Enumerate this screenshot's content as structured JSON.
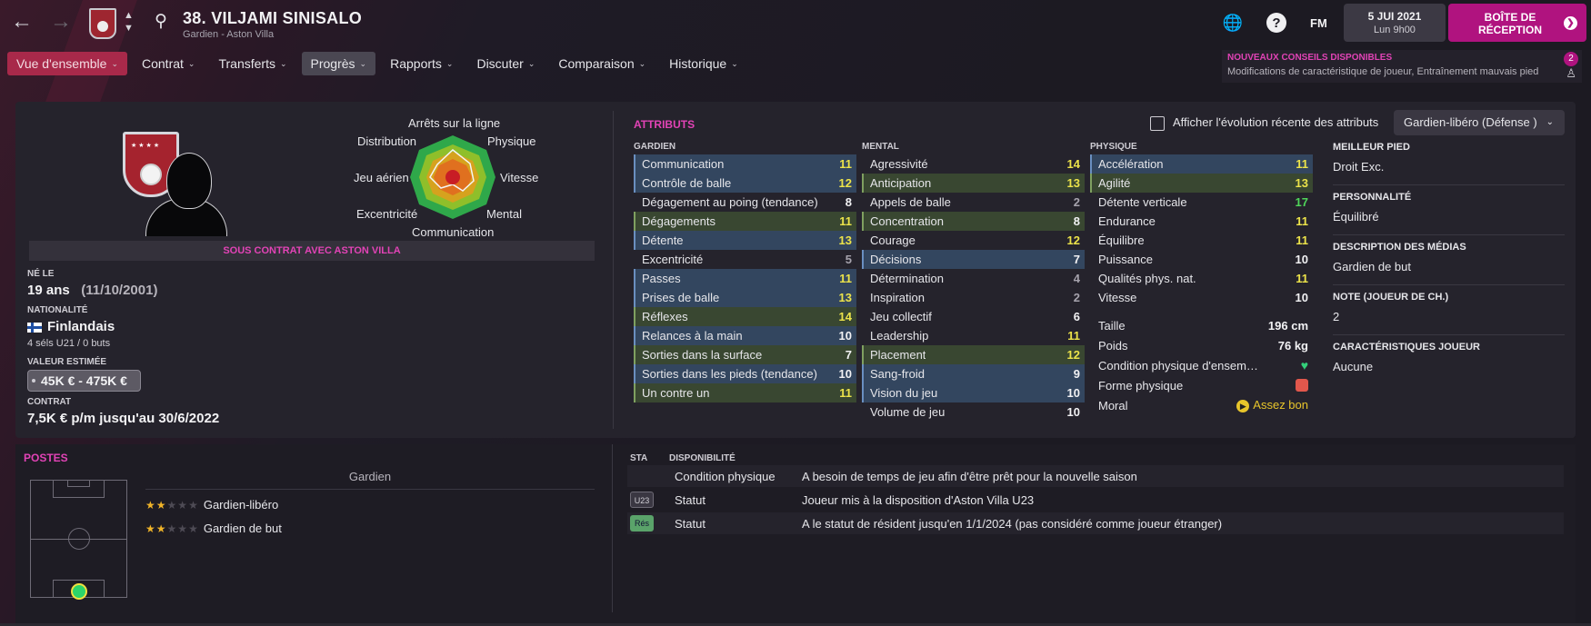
{
  "header": {
    "player_title": "38. VILJAMI SINISALO",
    "player_subtitle": "Gardien - Aston Villa",
    "fm_label": "FM",
    "date_main": "5 JUI 2021",
    "date_sub": "Lun 9h00",
    "inbox_label": "BOÎTE DE RÉCEPTION",
    "help_glyph": "?",
    "icons": [
      "back-arrow-icon",
      "forward-arrow-icon",
      "club-badge-icon",
      "search-icon",
      "globe-icon",
      "help-icon",
      "chevron-right-icon"
    ]
  },
  "tabs": [
    {
      "label": "Vue d'ensemble",
      "state": "active"
    },
    {
      "label": "Contrat"
    },
    {
      "label": "Transferts"
    },
    {
      "label": "Progrès",
      "state": "hover"
    },
    {
      "label": "Rapports"
    },
    {
      "label": "Discuter"
    },
    {
      "label": "Comparaison"
    },
    {
      "label": "Historique"
    }
  ],
  "notification": {
    "title": "NOUVEAUX CONSEILS DISPONIBLES",
    "text": "Modifications de caractéristique de joueur, Entraînement mauvais pied",
    "badge": "2"
  },
  "radar": {
    "labels": {
      "top": "Arrêts sur la ligne",
      "top_left": "Distribution",
      "top_right": "Physique",
      "left": "Jeu aérien",
      "right": "Vitesse",
      "bottom_left": "Excentricité",
      "bottom_right": "Mental",
      "bottom": "Communication"
    }
  },
  "profile": {
    "contract_banner": "SOUS CONTRAT AVEC ASTON VILLA",
    "born_label": "NÉ LE",
    "age": "19 ans",
    "birth_date": "(11/10/2001)",
    "nationality_label": "NATIONALITÉ",
    "nationality": "Finlandais",
    "caps": "4 séls U21 / 0 buts",
    "value_label": "VALEUR ESTIMÉE",
    "value": "45K € - 475K €",
    "contract_label": "CONTRAT",
    "contract": "7,5K € p/m jusqu'au 30/6/2022"
  },
  "attributes": {
    "title": "ATTRIBUTS",
    "show_recent_label": "Afficher l'évolution récente des attributs",
    "role_select": "Gardien-libéro (Défense )",
    "goalkeeper_head": "GARDIEN",
    "mental_head": "MENTAL",
    "physical_head": "PHYSIQUE",
    "goalkeeper": [
      {
        "name": "Communication",
        "value": "11",
        "hl": "b",
        "tone": "yellow"
      },
      {
        "name": "Contrôle de balle",
        "value": "12",
        "hl": "b",
        "tone": "yellow"
      },
      {
        "name": "Dégagement au poing (tendance)",
        "value": "8",
        "hl": "",
        "tone": "white"
      },
      {
        "name": "Dégagements",
        "value": "11",
        "hl": "g",
        "tone": "yellow"
      },
      {
        "name": "Détente",
        "value": "13",
        "hl": "b",
        "tone": "yellow"
      },
      {
        "name": "Excentricité",
        "value": "5",
        "hl": "",
        "tone": "grey"
      },
      {
        "name": "Passes",
        "value": "11",
        "hl": "b",
        "tone": "yellow"
      },
      {
        "name": "Prises de balle",
        "value": "13",
        "hl": "b",
        "tone": "yellow"
      },
      {
        "name": "Réflexes",
        "value": "14",
        "hl": "g",
        "tone": "yellow"
      },
      {
        "name": "Relances à la main",
        "value": "10",
        "hl": "b",
        "tone": "white"
      },
      {
        "name": "Sorties dans la surface",
        "value": "7",
        "hl": "g",
        "tone": "white"
      },
      {
        "name": "Sorties dans les pieds (tendance)",
        "value": "10",
        "hl": "b",
        "tone": "white"
      },
      {
        "name": "Un contre un",
        "value": "11",
        "hl": "g",
        "tone": "yellow"
      }
    ],
    "mental": [
      {
        "name": "Agressivité",
        "value": "14",
        "hl": "",
        "tone": "yellow"
      },
      {
        "name": "Anticipation",
        "value": "13",
        "hl": "g",
        "tone": "yellow"
      },
      {
        "name": "Appels de balle",
        "value": "2",
        "hl": "",
        "tone": "grey"
      },
      {
        "name": "Concentration",
        "value": "8",
        "hl": "g",
        "tone": "white"
      },
      {
        "name": "Courage",
        "value": "12",
        "hl": "",
        "tone": "yellow"
      },
      {
        "name": "Décisions",
        "value": "7",
        "hl": "b",
        "tone": "white"
      },
      {
        "name": "Détermination",
        "value": "4",
        "hl": "",
        "tone": "grey"
      },
      {
        "name": "Inspiration",
        "value": "2",
        "hl": "",
        "tone": "grey"
      },
      {
        "name": "Jeu collectif",
        "value": "6",
        "hl": "",
        "tone": "white"
      },
      {
        "name": "Leadership",
        "value": "11",
        "hl": "",
        "tone": "yellow"
      },
      {
        "name": "Placement",
        "value": "12",
        "hl": "g",
        "tone": "yellow"
      },
      {
        "name": "Sang-froid",
        "value": "9",
        "hl": "b",
        "tone": "white"
      },
      {
        "name": "Vision du jeu",
        "value": "10",
        "hl": "b",
        "tone": "white"
      },
      {
        "name": "Volume de jeu",
        "value": "10",
        "hl": "",
        "tone": "white"
      }
    ],
    "physical": [
      {
        "name": "Accélération",
        "value": "11",
        "hl": "b",
        "tone": "yellow"
      },
      {
        "name": "Agilité",
        "value": "13",
        "hl": "g",
        "tone": "yellow"
      },
      {
        "name": "Détente verticale",
        "value": "17",
        "hl": "",
        "tone": "green"
      },
      {
        "name": "Endurance",
        "value": "11",
        "hl": "",
        "tone": "yellow"
      },
      {
        "name": "Équilibre",
        "value": "11",
        "hl": "",
        "tone": "yellow"
      },
      {
        "name": "Puissance",
        "value": "10",
        "hl": "",
        "tone": "white"
      },
      {
        "name": "Qualités phys. nat.",
        "value": "11",
        "hl": "",
        "tone": "yellow"
      },
      {
        "name": "Vitesse",
        "value": "10",
        "hl": "",
        "tone": "white"
      }
    ],
    "height_label": "Taille",
    "height": "196 cm",
    "weight_label": "Poids",
    "weight": "76 kg",
    "condition_label": "Condition physique d'ensem…",
    "form_label": "Forme physique",
    "morale_label": "Moral",
    "morale": "Assez bon"
  },
  "info": {
    "foot_label": "MEILLEUR PIED",
    "foot": "Droit Exc.",
    "personality_label": "PERSONNALITÉ",
    "personality": "Équilibré",
    "media_label": "DESCRIPTION DES MÉDIAS",
    "media": "Gardien de but",
    "note_label": "NOTE (JOUEUR DE CH.)",
    "note": "2",
    "traits_label": "CARACTÉRISTIQUES JOUEUR",
    "traits": "Aucune"
  },
  "positions": {
    "title": "POSTES",
    "group": "Gardien",
    "roles": [
      {
        "name": "Gardien-libéro",
        "stars": 1.5
      },
      {
        "name": "Gardien de but",
        "stars": 1.5
      }
    ]
  },
  "availability": {
    "sta_head": "STA",
    "head": "DISPONIBILITÉ",
    "rows": [
      {
        "tag": "",
        "type": "Condition physique",
        "desc": "A besoin de temps de jeu afin d'être prêt pour la nouvelle saison"
      },
      {
        "tag": "U23",
        "type": "Statut",
        "desc": "Joueur mis à la disposition d'Aston Villa U23"
      },
      {
        "tag": "Rés",
        "type": "Statut",
        "desc": "A le statut de résident jusqu'en 1/1/2024 (pas considéré comme joueur étranger)"
      }
    ]
  },
  "colors": {
    "accent": "#e243b6",
    "tab_active": "#a8294a",
    "inbox": "#b0137f"
  }
}
